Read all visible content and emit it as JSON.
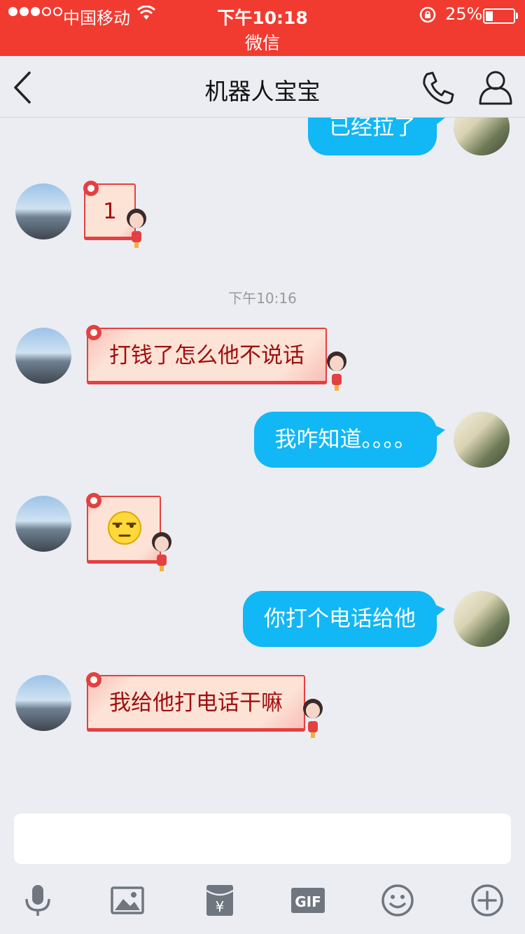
{
  "status_bar": {
    "carrier": "中国移动",
    "time": "下午10:18",
    "battery": "25%",
    "battery_level": 0.25,
    "return_app": "微信",
    "background_color": "#f23b30"
  },
  "nav": {
    "title": "机器人宝宝",
    "back_icon": "chevron-left-icon",
    "call_icon": "phone-icon",
    "profile_icon": "person-icon"
  },
  "messages": [
    {
      "side": "right",
      "style": "blue",
      "text": "已经拉了"
    },
    {
      "side": "left",
      "style": "red-sticker",
      "text": "1"
    },
    {
      "type": "timestamp",
      "text": "下午10:16"
    },
    {
      "side": "left",
      "style": "red-sticker",
      "text": "打钱了怎么他不说话"
    },
    {
      "side": "right",
      "style": "blue",
      "text": "我咋知道。。。。"
    },
    {
      "side": "left",
      "style": "red-sticker",
      "emoji": "unamused-face-icon"
    },
    {
      "side": "right",
      "style": "blue",
      "text": "你打个电话给他"
    },
    {
      "side": "left",
      "style": "red-sticker",
      "text": "我给他打电话干嘛"
    }
  ],
  "input": {
    "value": "",
    "placeholder": ""
  },
  "toolbar": {
    "icons": [
      "microphone-icon",
      "image-icon",
      "red-packet-icon",
      "gif-icon",
      "emoji-icon",
      "plus-icon"
    ],
    "gif_label": "GIF",
    "red_packet_label": "¥"
  },
  "colors": {
    "blue_bubble": "#12b7f5",
    "red_bubble_border": "#e34141",
    "red_bubble_text": "#a10f0f",
    "chat_background": "#ebedf2"
  }
}
